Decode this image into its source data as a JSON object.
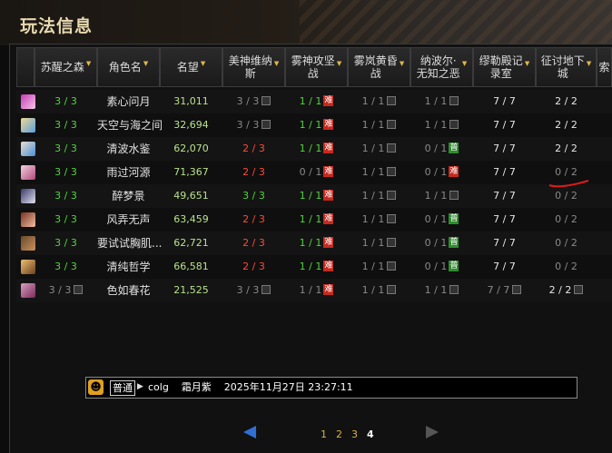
{
  "title": "玩法信息",
  "columns": [
    {
      "label": "苏醒之森",
      "sortable": true
    },
    {
      "label": "角色名",
      "sortable": true
    },
    {
      "label": "名望",
      "sortable": true
    },
    {
      "label": "美神维纳\n斯",
      "sortable": true
    },
    {
      "label": "雾神攻坚\n战",
      "sortable": true
    },
    {
      "label": "雾岚黄昏\n战",
      "sortable": true
    },
    {
      "label": "纳波尔·\n无知之恶",
      "sortable": true
    },
    {
      "label": "缪勒殿记\n录室",
      "sortable": true
    },
    {
      "label": "征讨地下\n城",
      "sortable": true
    },
    {
      "label": "索",
      "sortable": false
    }
  ],
  "tags": {
    "hard": "难",
    "normal": "普"
  },
  "rows": [
    {
      "wake": "3 / 3",
      "name": "素心问月",
      "fame": "31,011",
      "venus": "3 / 3",
      "mist": "1 / 1",
      "mist_tag": "难",
      "dusk": "1 / 1",
      "nabol": "1 / 1",
      "muller": "7 / 7",
      "dungeon": "2 / 2"
    },
    {
      "wake": "3 / 3",
      "name": "天空与海之间",
      "fame": "32,694",
      "venus": "3 / 3",
      "mist": "1 / 1",
      "mist_tag": "难",
      "dusk": "1 / 1",
      "nabol": "1 / 1",
      "muller": "7 / 7",
      "dungeon": "2 / 2"
    },
    {
      "wake": "3 / 3",
      "name": "清波水鉴",
      "fame": "62,070",
      "venus": "2 / 3",
      "mist": "1 / 1",
      "mist_tag": "难",
      "dusk": "1 / 1",
      "nabol": "0 / 1",
      "nabol_tag": "普",
      "muller": "7 / 7",
      "dungeon": "2 / 2"
    },
    {
      "wake": "3 / 3",
      "name": "雨过河源",
      "fame": "71,367",
      "venus": "2 / 3",
      "mist": "0 / 1",
      "mist_tag": "难",
      "dusk": "1 / 1",
      "nabol": "0 / 1",
      "nabol_tag": "难",
      "muller": "7 / 7",
      "dungeon": "0 / 2"
    },
    {
      "wake": "3 / 3",
      "name": "醉梦景",
      "fame": "49,651",
      "venus": "3 / 3",
      "mist": "1 / 1",
      "mist_tag": "难",
      "dusk": "1 / 1",
      "nabol": "1 / 1",
      "muller": "7 / 7",
      "dungeon": "0 / 2"
    },
    {
      "wake": "3 / 3",
      "name": "风弄无声",
      "fame": "63,459",
      "venus": "2 / 3",
      "mist": "1 / 1",
      "mist_tag": "难",
      "dusk": "1 / 1",
      "nabol": "0 / 1",
      "nabol_tag": "普",
      "muller": "7 / 7",
      "dungeon": "0 / 2"
    },
    {
      "wake": "3 / 3",
      "name": "要试试胸肌...",
      "fame": "62,721",
      "venus": "2 / 3",
      "mist": "1 / 1",
      "mist_tag": "难",
      "dusk": "1 / 1",
      "nabol": "0 / 1",
      "nabol_tag": "普",
      "muller": "7 / 7",
      "dungeon": "0 / 2"
    },
    {
      "wake": "3 / 3",
      "name": "清纯哲学",
      "fame": "66,581",
      "venus": "2 / 3",
      "mist": "1 / 1",
      "mist_tag": "难",
      "dusk": "1 / 1",
      "nabol": "0 / 1",
      "nabol_tag": "普",
      "muller": "7 / 7",
      "dungeon": "0 / 2"
    },
    {
      "wake": "3 / 3",
      "name": "色如春花",
      "fame": "21,525",
      "venus": "3 / 3",
      "mist": "1 / 1",
      "mist_tag": "难",
      "dusk": "1 / 1",
      "nabol": "1 / 1",
      "muller": "7 / 7",
      "dungeon": "2 / 2"
    }
  ],
  "chat": {
    "emoji": "☻",
    "mode": "普通",
    "text": "colg    霜月紫    2025年11月27日 23:27:11"
  },
  "pagination": {
    "pages": [
      "1",
      "2",
      "3",
      "4"
    ],
    "current": "4"
  }
}
